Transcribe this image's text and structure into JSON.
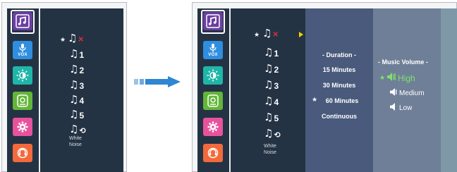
{
  "colors": {
    "screen_bg": "#243344",
    "duration_panel": "#4a5a7c",
    "volume_panel": "#6f7f98",
    "music_icon": "#6a3ea1",
    "vox_icon": "#2f8ee0",
    "brightness_icon": "#1fb6a8",
    "sound_sensor_icon": "#63b638",
    "settings_icon": "#e8529d",
    "support_icon": "#f26a3c",
    "active_volume": "#7ee26a",
    "off_x": "#e0303a",
    "arrow": "#2f86d2"
  },
  "sidebar_icons": [
    "music-note-icon",
    "microphone-vox-icon",
    "brightness-icon",
    "sound-sensor-icon",
    "settings-gear-icon",
    "support-headset-icon"
  ],
  "vox_label": "VOX",
  "sounds": {
    "numbers": [
      "1",
      "2",
      "3",
      "4",
      "5"
    ],
    "white_noise_line1": "White",
    "white_noise_line2": "Noise",
    "selected_marker": "★"
  },
  "duration": {
    "title": "- Duration -",
    "options": [
      "15 Minutes",
      "30 Minutes",
      "60 Minutes",
      "Continuous"
    ],
    "selected": "60 Minutes"
  },
  "volume": {
    "title": "- Music Volume -",
    "options": [
      "High",
      "Medium",
      "Low"
    ],
    "selected": "High"
  }
}
